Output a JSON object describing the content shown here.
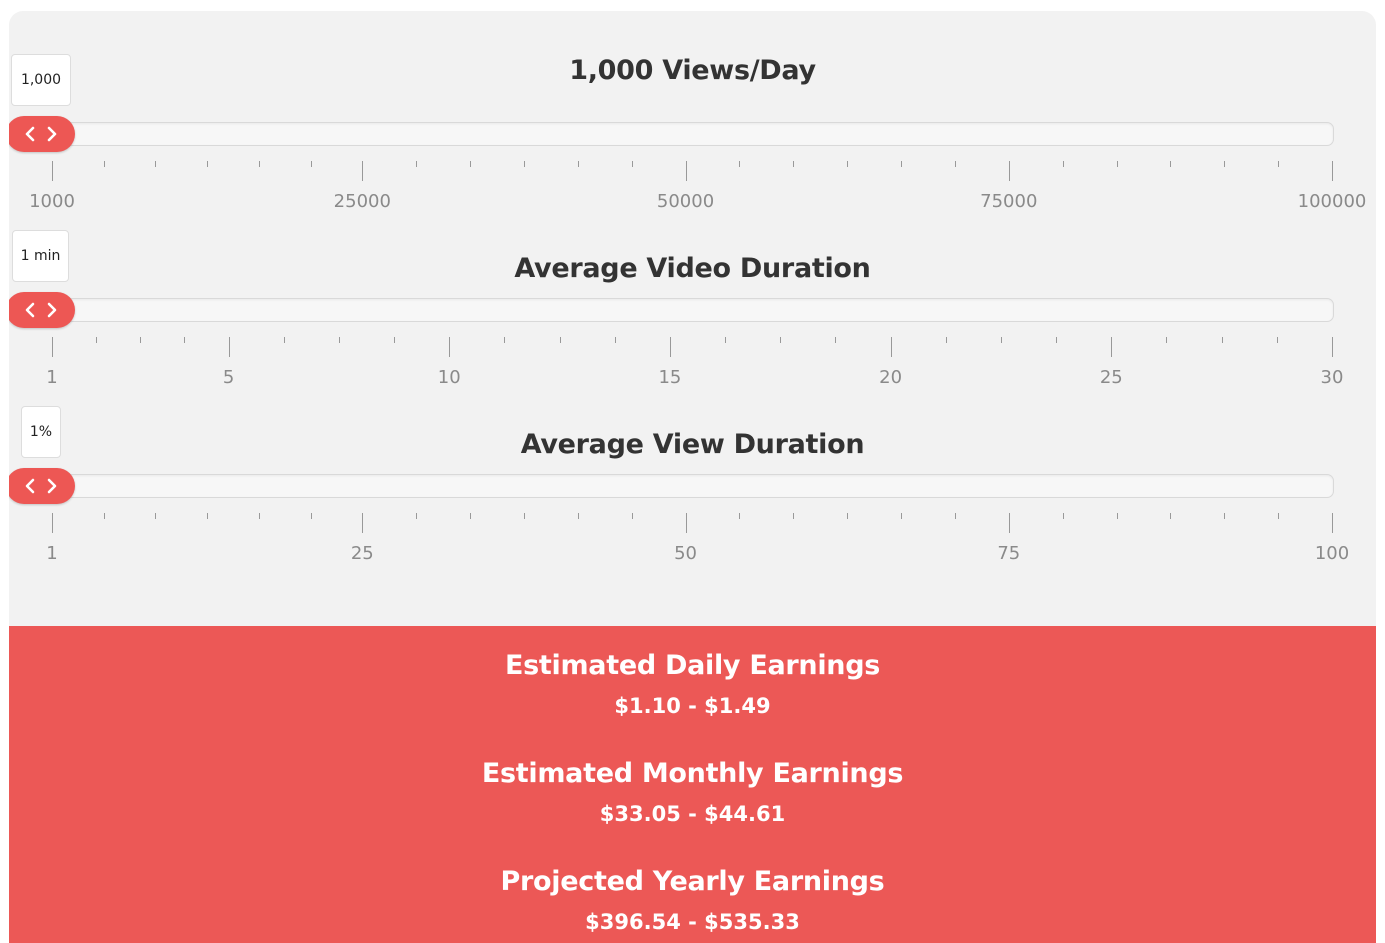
{
  "sliders": [
    {
      "id": "views",
      "title": "1,000 Views/Day",
      "value_display": "1,000",
      "value": 1000,
      "min": 1000,
      "max": 100000,
      "major_ticks": [
        {
          "value": 1000,
          "label": "1000"
        },
        {
          "value": 25000,
          "label": "25000"
        },
        {
          "value": 50000,
          "label": "50000"
        },
        {
          "value": 75000,
          "label": "75000"
        },
        {
          "value": 100000,
          "label": "100000"
        }
      ],
      "minor_per_interval": 5
    },
    {
      "id": "video-duration",
      "title": "Average Video Duration",
      "value_display": "1 min",
      "value": 1,
      "min": 1,
      "max": 30,
      "major_ticks": [
        {
          "value": 1,
          "label": "1"
        },
        {
          "value": 5,
          "label": "5"
        },
        {
          "value": 10,
          "label": "10"
        },
        {
          "value": 15,
          "label": "15"
        },
        {
          "value": 20,
          "label": "20"
        },
        {
          "value": 25,
          "label": "25"
        },
        {
          "value": 30,
          "label": "30"
        }
      ],
      "minor_per_interval": 3
    },
    {
      "id": "view-duration",
      "title": "Average View Duration",
      "value_display": "1%",
      "value": 1,
      "min": 1,
      "max": 100,
      "major_ticks": [
        {
          "value": 1,
          "label": "1"
        },
        {
          "value": 25,
          "label": "25"
        },
        {
          "value": 50,
          "label": "50"
        },
        {
          "value": 75,
          "label": "75"
        },
        {
          "value": 100,
          "label": "100"
        }
      ],
      "minor_per_interval": 5
    }
  ],
  "results": [
    {
      "heading": "Estimated Daily Earnings",
      "value": "$1.10 - $1.49"
    },
    {
      "heading": "Estimated Monthly Earnings",
      "value": "$33.05 - $44.61"
    },
    {
      "heading": "Projected Yearly Earnings",
      "value": "$396.54 - $535.33"
    }
  ],
  "icons": {
    "left": "chevron-left-icon",
    "right": "chevron-right-icon"
  },
  "colors": {
    "accent": "#ec5856",
    "panel": "#f2f2f2",
    "text": "#333333",
    "tick_label": "#8a8a8a"
  }
}
